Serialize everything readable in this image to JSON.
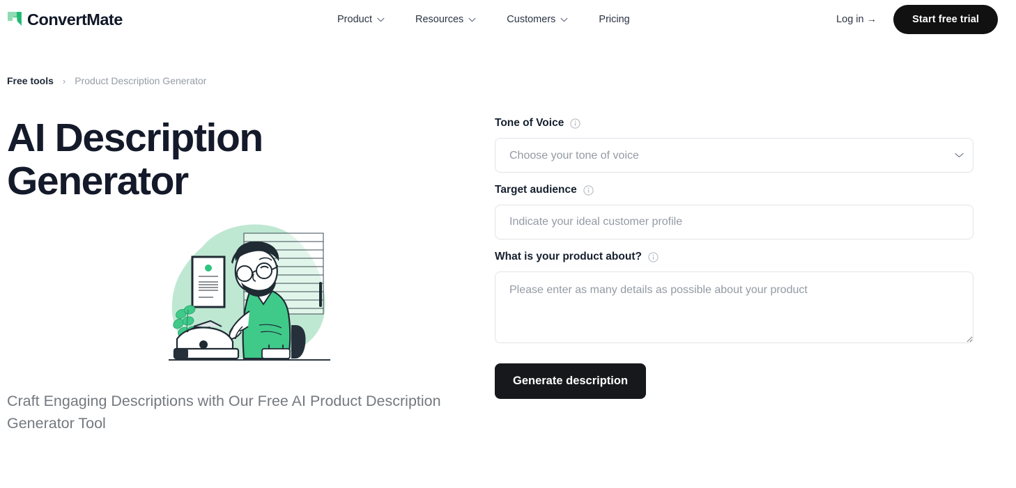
{
  "header": {
    "brand_name": "ConvertMate",
    "brand_mark_icon": "green-pennant-logo-icon",
    "nav": [
      {
        "label": "Product",
        "has_chevron": true,
        "icon": "chevron-down-icon"
      },
      {
        "label": "Resources",
        "has_chevron": true,
        "icon": "chevron-down-icon"
      },
      {
        "label": "Customers",
        "has_chevron": true,
        "icon": "chevron-down-icon"
      },
      {
        "label": "Pricing",
        "has_chevron": false,
        "icon": ""
      }
    ],
    "login_label": "Log in →",
    "cta_label": "Start free trial"
  },
  "breadcrumb": {
    "home_label": "Free tools",
    "separator": "›",
    "current_label": "Product Description Generator"
  },
  "hero": {
    "title": "AI Description Generator",
    "subtitle": "Craft Engaging Descriptions with Our Free AI Product Description Generator Tool",
    "illustration_icon": "man-typing-on-typewriter-illustration"
  },
  "form": {
    "tone": {
      "label": "Tone of Voice",
      "info_icon": "info-circle-icon",
      "placeholder": "Choose your tone of voice",
      "selected": "Choose your tone of voice",
      "chevron_icon": "chevron-down-icon"
    },
    "audience": {
      "label": "Target audience",
      "info_icon": "info-circle-icon",
      "placeholder": "Indicate your ideal customer profile",
      "value": ""
    },
    "product": {
      "label": "What is your product about?",
      "info_icon": "info-circle-icon",
      "placeholder": "Please enter as many details as possible about your product",
      "value": ""
    },
    "submit_label": "Generate description"
  },
  "colors": {
    "brand_green": "#2fc47f",
    "blob_mint": "#bfe8d3",
    "ink": "#141a2a",
    "muted": "#74797f",
    "border": "#e0e3e7",
    "dark_button": "#111111"
  }
}
